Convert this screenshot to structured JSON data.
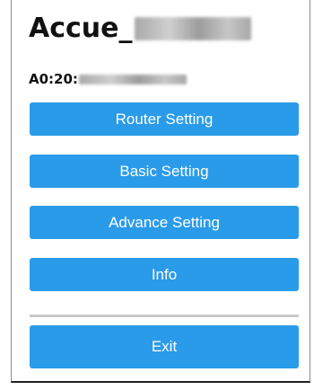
{
  "header": {
    "device_name_prefix": "Accue_",
    "mac_prefix": "A0:20:"
  },
  "menu": {
    "router_setting": "Router Setting",
    "basic_setting": "Basic Setting",
    "advance_setting": "Advance Setting",
    "info": "Info",
    "exit": "Exit"
  },
  "colors": {
    "button": "#2a9be8",
    "button_text": "#ffffff"
  }
}
